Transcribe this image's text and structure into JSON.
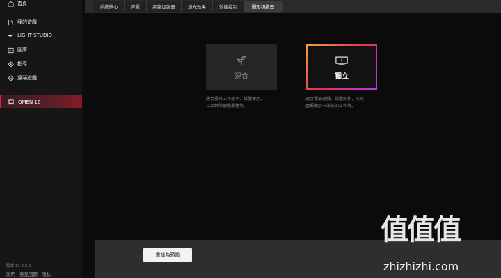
{
  "sidebar": {
    "items": [
      {
        "label": "首頁",
        "icon": "home-icon"
      },
      {
        "label": "我的遊戲",
        "icon": "library-icon"
      },
      {
        "label": "LIGHT STUDIO",
        "icon": "sparkle-icon"
      },
      {
        "label": "圖庫",
        "icon": "gallery-icon"
      },
      {
        "label": "指導",
        "icon": "coach-icon"
      },
      {
        "label": "遠端遊戲",
        "icon": "remote-icon"
      }
    ],
    "device": {
      "label": "OMEN 16",
      "icon": "laptop-icon"
    },
    "version": "版本 11.8.5.0",
    "footer": [
      "說明",
      "意見回饋",
      "隱私"
    ]
  },
  "tabs": [
    {
      "label": "系統核心",
      "active": false
    },
    {
      "label": "降壓",
      "active": false
    },
    {
      "label": "網路加強器",
      "active": false
    },
    {
      "label": "燈光效果",
      "active": false
    },
    {
      "label": "效能控制",
      "active": false
    },
    {
      "label": "圖形切換器",
      "active": true
    }
  ],
  "modes": {
    "hybrid": {
      "title": "混合",
      "icon": "leaf-icon",
      "description_line1": "適合提升工作效率、媒體使用，",
      "description_line2": "以及網際網路瀏覽等。"
    },
    "discrete": {
      "title": "獨立",
      "icon": "monitor-icon",
      "selected": true,
      "description_line1": "適合電競遊戲、媒體創作，以及",
      "description_line2": "虛擬顯示卡效能的工作等。"
    }
  },
  "bottom": {
    "reset_label": "重設為預設"
  },
  "watermark": {
    "logo": "值值值",
    "site": "zhizhizhi.com"
  },
  "colors": {
    "accent": "#e3203f",
    "gradient_start": "#f5a13a",
    "gradient_mid": "#e3305a",
    "gradient_end": "#b33af0"
  }
}
